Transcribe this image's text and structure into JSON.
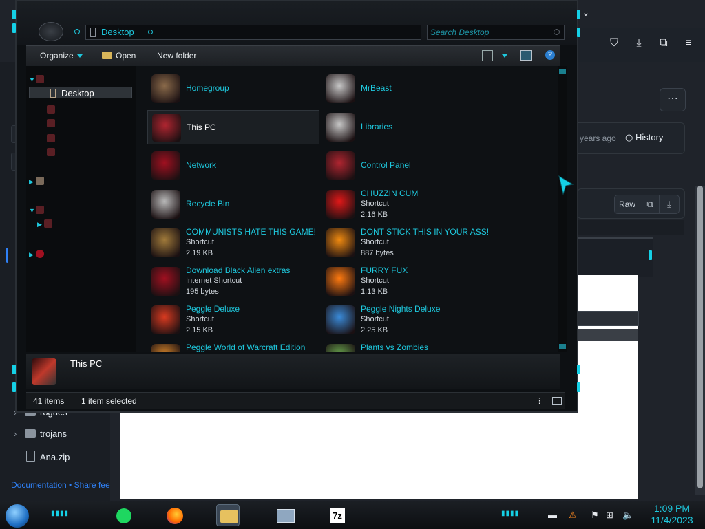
{
  "window": {
    "address": "Desktop",
    "search_placeholder": "Search Desktop"
  },
  "toolbar": {
    "organize": "Organize",
    "open": "Open",
    "new_folder": "New folder"
  },
  "nav": {
    "selected": "Desktop"
  },
  "items": [
    {
      "title": "Homegroup",
      "type": "",
      "size": "",
      "icon": "homegroup-icon",
      "color": "#8a6a4a"
    },
    {
      "title": "MrBeast",
      "type": "",
      "size": "",
      "icon": "user-folder-icon",
      "color": "#c7c7c7"
    },
    {
      "title": "This PC",
      "type": "",
      "size": "",
      "icon": "computer-icon",
      "color": "#b02530"
    },
    {
      "title": "Libraries",
      "type": "",
      "size": "",
      "icon": "libraries-icon",
      "color": "#c7c7c7"
    },
    {
      "title": "Network",
      "type": "",
      "size": "",
      "icon": "network-icon",
      "color": "#a01020"
    },
    {
      "title": "Control Panel",
      "type": "",
      "size": "",
      "icon": "control-panel-icon",
      "color": "#b02530"
    },
    {
      "title": "Recycle Bin",
      "type": "",
      "size": "",
      "icon": "recycle-bin-icon",
      "color": "#b8b8b8"
    },
    {
      "title": "CHUZZIN CUM",
      "type": "Shortcut",
      "size": "2.16 KB",
      "icon": "chuzzle-icon",
      "color": "#e01818"
    },
    {
      "title": "COMMUNISTS HATE THIS GAME!",
      "type": "Shortcut",
      "size": "2.19 KB",
      "icon": "money-bag-icon",
      "color": "#a07a3a"
    },
    {
      "title": "DONT STICK THIS IN YOUR ASS!",
      "type": "Shortcut",
      "size": "887 bytes",
      "icon": "vlc-cone-icon",
      "color": "#f08a10"
    },
    {
      "title": "Download Black Alien extras",
      "type": "Internet Shortcut",
      "size": "195 bytes",
      "icon": "network-icon",
      "color": "#a01020"
    },
    {
      "title": "FURRY FUX",
      "type": "Shortcut",
      "size": "1.13 KB",
      "icon": "firefox-icon",
      "color": "#ff7a10"
    },
    {
      "title": "Peggle Deluxe",
      "type": "Shortcut",
      "size": "2.15 KB",
      "icon": "peggle-icon",
      "color": "#d83a20"
    },
    {
      "title": "Peggle Nights Deluxe",
      "type": "Shortcut",
      "size": "2.25 KB",
      "icon": "peggle-nights-icon",
      "color": "#3a8ad8"
    },
    {
      "title": "Peggle World of Warcraft Edition",
      "type": "",
      "size": "",
      "icon": "peggle-wow-icon",
      "color": "#d8862a"
    },
    {
      "title": "Plants vs Zombies",
      "type": "",
      "size": "",
      "icon": "pvz-icon",
      "color": "#6aa84f"
    }
  ],
  "details": {
    "name": "This PC"
  },
  "status": {
    "count": "41 items",
    "selected": "1 item selected"
  },
  "browser": {
    "ago": "years ago",
    "history": "History",
    "raw": "Raw",
    "tree": [
      {
        "label": "rogues",
        "kind": "folder"
      },
      {
        "label": "trojans",
        "kind": "folder"
      },
      {
        "label": "Ana.zip",
        "kind": "file"
      }
    ],
    "links": "Documentation • Share fee"
  },
  "clock": {
    "time": "1:09 PM",
    "date": "11/4/2023"
  }
}
